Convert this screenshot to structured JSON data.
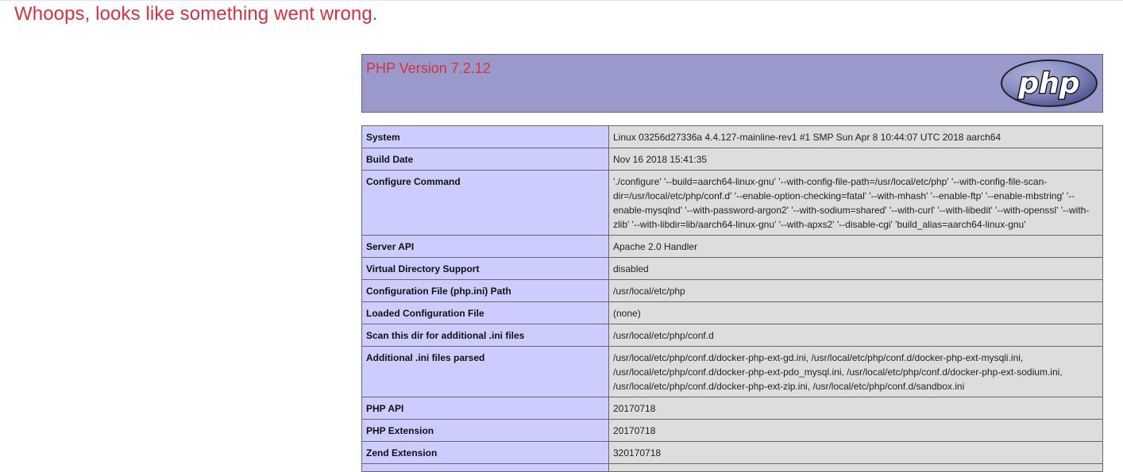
{
  "page": {
    "error_title": "Whoops, looks like something went wrong."
  },
  "phpinfo": {
    "version_title": "PHP Version 7.2.12",
    "logo_text": "php",
    "logo_icon": "php-logo",
    "colors": {
      "header_bg": "#9999cc",
      "key_bg": "#ccccff",
      "value_bg": "#dddddd",
      "error_red": "#d9303e"
    },
    "rows": [
      {
        "key": "System",
        "value": "Linux 03256d27336a 4.4.127-mainline-rev1 #1 SMP Sun Apr 8 10:44:07 UTC 2018 aarch64"
      },
      {
        "key": "Build Date",
        "value": "Nov 16 2018 15:41:35"
      },
      {
        "key": "Configure Command",
        "value": "'./configure' '--build=aarch64-linux-gnu' '--with-config-file-path=/usr/local/etc/php' '--with-config-file-scan-dir=/usr/local/etc/php/conf.d' '--enable-option-checking=fatal' '--with-mhash' '--enable-ftp' '--enable-mbstring' '--enable-mysqlnd' '--with-password-argon2' '--with-sodium=shared' '--with-curl' '--with-libedit' '--with-openssl' '--with-zlib' '--with-libdir=lib/aarch64-linux-gnu' '--with-apxs2' '--disable-cgi' 'build_alias=aarch64-linux-gnu'"
      },
      {
        "key": "Server API",
        "value": "Apache 2.0 Handler"
      },
      {
        "key": "Virtual Directory Support",
        "value": "disabled"
      },
      {
        "key": "Configuration File (php.ini) Path",
        "value": "/usr/local/etc/php"
      },
      {
        "key": "Loaded Configuration File",
        "value": "(none)"
      },
      {
        "key": "Scan this dir for additional .ini files",
        "value": "/usr/local/etc/php/conf.d"
      },
      {
        "key": "Additional .ini files parsed",
        "value": "/usr/local/etc/php/conf.d/docker-php-ext-gd.ini, /usr/local/etc/php/conf.d/docker-php-ext-mysqli.ini, /usr/local/etc/php/conf.d/docker-php-ext-pdo_mysql.ini, /usr/local/etc/php/conf.d/docker-php-ext-sodium.ini, /usr/local/etc/php/conf.d/docker-php-ext-zip.ini, /usr/local/etc/php/conf.d/sandbox.ini"
      },
      {
        "key": "PHP API",
        "value": "20170718"
      },
      {
        "key": "PHP Extension",
        "value": "20170718"
      },
      {
        "key": "Zend Extension",
        "value": "320170718"
      },
      {
        "key": "",
        "value": ""
      }
    ]
  }
}
